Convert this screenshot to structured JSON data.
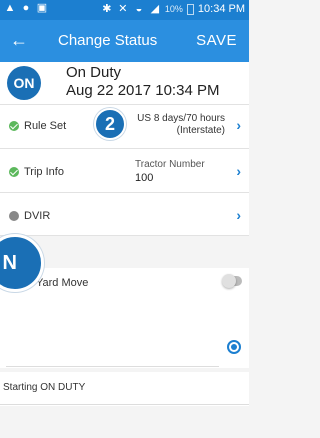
{
  "status_bar": {
    "time": "10:34 PM",
    "battery": "10%",
    "left_icons": [
      "warning-icon",
      "record-icon",
      "image-icon"
    ],
    "right_icons": [
      "bluetooth-icon",
      "mute-icon",
      "wifi-icon",
      "signal-icon",
      "battery-icon"
    ]
  },
  "appbar": {
    "back_icon": "back-arrow-icon",
    "title": "Change Status",
    "save_label": "SAVE",
    "color": "#2b8fe0"
  },
  "status": {
    "badge": "ON",
    "name": "On Duty",
    "date": "Aug 22 2017 10:34 PM",
    "badge_color": "#1a6fb5"
  },
  "rows": {
    "rule_set": {
      "label": "Rule Set",
      "value_line1": "US 8 days/70 hours",
      "value_line2": "(Interstate)"
    },
    "trip_info": {
      "label": "Trip Info",
      "key": "Tractor Number",
      "value": "100"
    },
    "dvir": {
      "label": "DVIR"
    }
  },
  "callout": {
    "number": "2"
  },
  "yard_move": {
    "label": "Yard Move",
    "toggle_on": false
  },
  "location": {
    "value": "",
    "icon": "gps-target-icon"
  },
  "note": {
    "text": "Starting ON DUTY"
  },
  "side_badge": {
    "text": "N"
  }
}
